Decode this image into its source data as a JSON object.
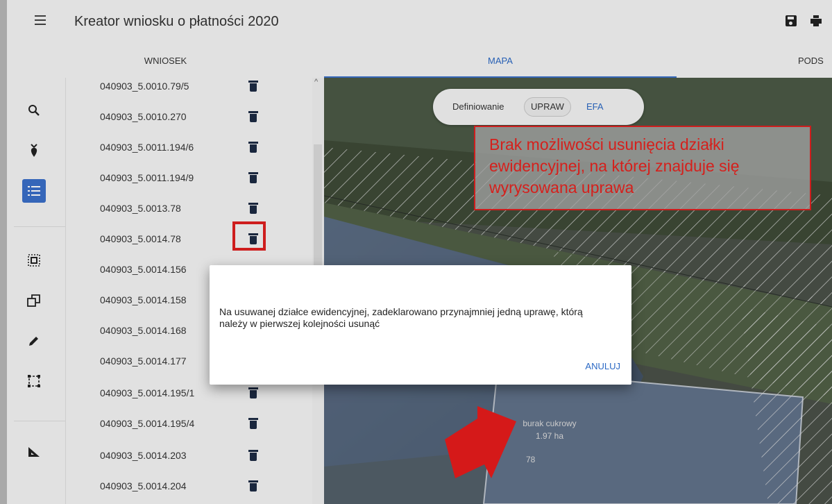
{
  "header": {
    "title": "Kreator wniosku o płatności 2020",
    "menu_icon": "menu-icon",
    "save_icon": "save-icon",
    "print_icon": "print-icon"
  },
  "tabs": [
    {
      "label": "WNIOSEK"
    },
    {
      "label": "MAPA",
      "active": true
    },
    {
      "label": "PODS"
    }
  ],
  "rail": {
    "items": [
      "search-icon",
      "crop-icon",
      "list-icon",
      "select-area-icon",
      "copy-icon",
      "pencil-icon",
      "bounding-box-icon",
      "measure-icon"
    ],
    "active": "list-icon"
  },
  "parcels": [
    {
      "id": "040903_5.0010.79/5"
    },
    {
      "id": "040903_5.0010.270"
    },
    {
      "id": "040903_5.0011.194/6"
    },
    {
      "id": "040903_5.0011.194/9"
    },
    {
      "id": "040903_5.0013.78"
    },
    {
      "id": "040903_5.0014.78"
    },
    {
      "id": "040903_5.0014.156"
    },
    {
      "id": "040903_5.0014.158"
    },
    {
      "id": "040903_5.0014.168"
    },
    {
      "id": "040903_5.0014.177"
    },
    {
      "id": "040903_5.0014.195/1"
    },
    {
      "id": "040903_5.0014.195/4"
    },
    {
      "id": "040903_5.0014.203"
    },
    {
      "id": "040903_5.0014.204"
    }
  ],
  "map": {
    "toggle": {
      "label": "Definiowanie",
      "upraw": "UPRAW",
      "efa": "EFA"
    },
    "callout": "Brak możliwości usunięcia działki ewidencyjnej, na której znajduje się wyrysowana uprawa",
    "field_crop": "burak cukrowy",
    "field_area": "1.97 ha",
    "parcel_number": "78"
  },
  "dialog": {
    "message": "Na usuwanej działce ewidencyjnej, zadeklarowano przynajmniej jedną uprawę, którą należy w pierwszej kolejności usunąć",
    "cancel_label": "ANULUJ"
  },
  "colors": {
    "accent": "#3a6fc9",
    "alert": "#e02020"
  }
}
